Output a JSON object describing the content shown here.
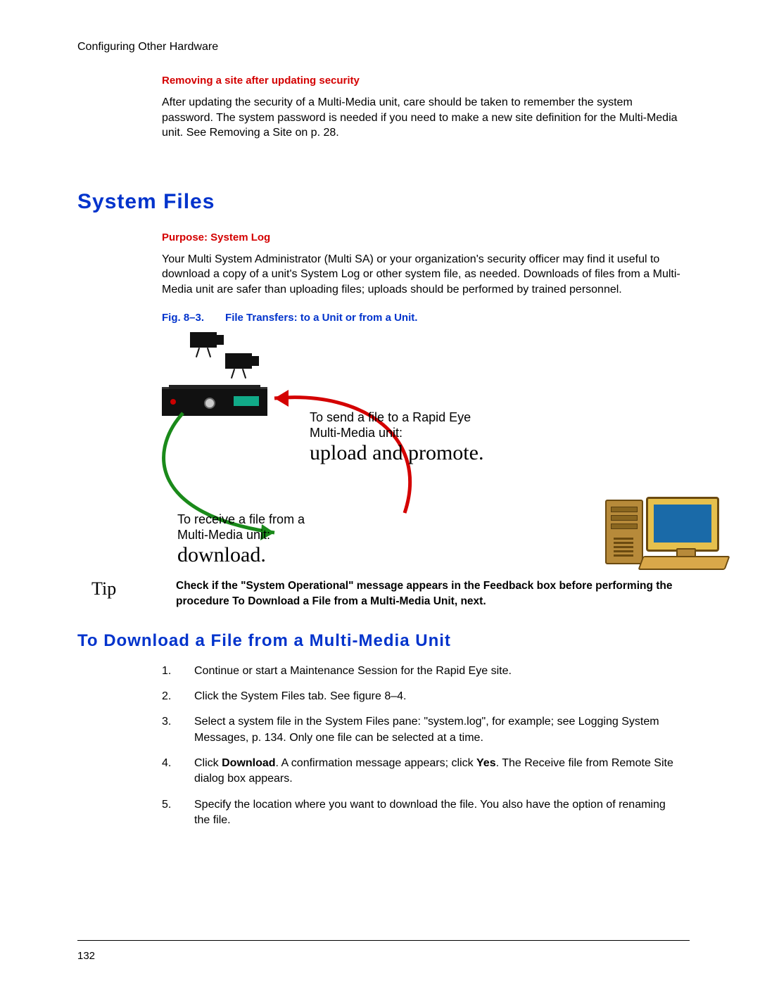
{
  "header": "Configuring Other Hardware",
  "section1": {
    "subhead": "Removing a site after updating security",
    "body": "After updating the security of a Multi-Media unit, care should be taken to remember the system password. The system password is needed if you need to make a new site definition for the Multi-Media unit. See Removing a Site on p. 28."
  },
  "h1": "System Files",
  "section2": {
    "subhead": "Purpose: System Log",
    "body": "Your Multi System Administrator (Multi SA) or your organization's security officer may find it useful to download a copy of a unit's System Log or other system file, as needed. Downloads of files from a Multi-Media unit are safer than uploading files; uploads should be performed by trained personnel."
  },
  "figure": {
    "num": "Fig. 8–3.",
    "title": "File Transfers: to a Unit or from a Unit.",
    "upload_small": "To send a file to a Rapid Eye Multi-Media unit:",
    "upload_big": "upload and promote.",
    "download_small": "To receive a file from a Multi-Media unit:",
    "download_big": "download."
  },
  "tip": {
    "label": "Tip",
    "text_before": "Check if the \"System Operational\" message appears in the Feedback box before performing the procedure To Download a File from a Multi-Media Unit, next."
  },
  "h2": "To Download a File from a Multi-Media Unit",
  "steps": [
    "Continue or start a Maintenance Session for the Rapid Eye site.",
    "Click the System Files tab. See figure 8–4.",
    "Select a system file in the System Files pane: \"system.log\", for example; see Logging System Messages, p. 134. Only one file can be selected at a time.",
    "Click Download. A confirmation message appears; click Yes. The Receive file from Remote Site dialog box appears.",
    "Specify the location where you want to download the file. You also have the option of renaming the file."
  ],
  "steps_rich": {
    "3_html": "Click <b>Download</b>. A confirmation message appears; click <b>Yes</b>. The Receive file from Remote Site dialog box appears."
  },
  "page_number": "132"
}
